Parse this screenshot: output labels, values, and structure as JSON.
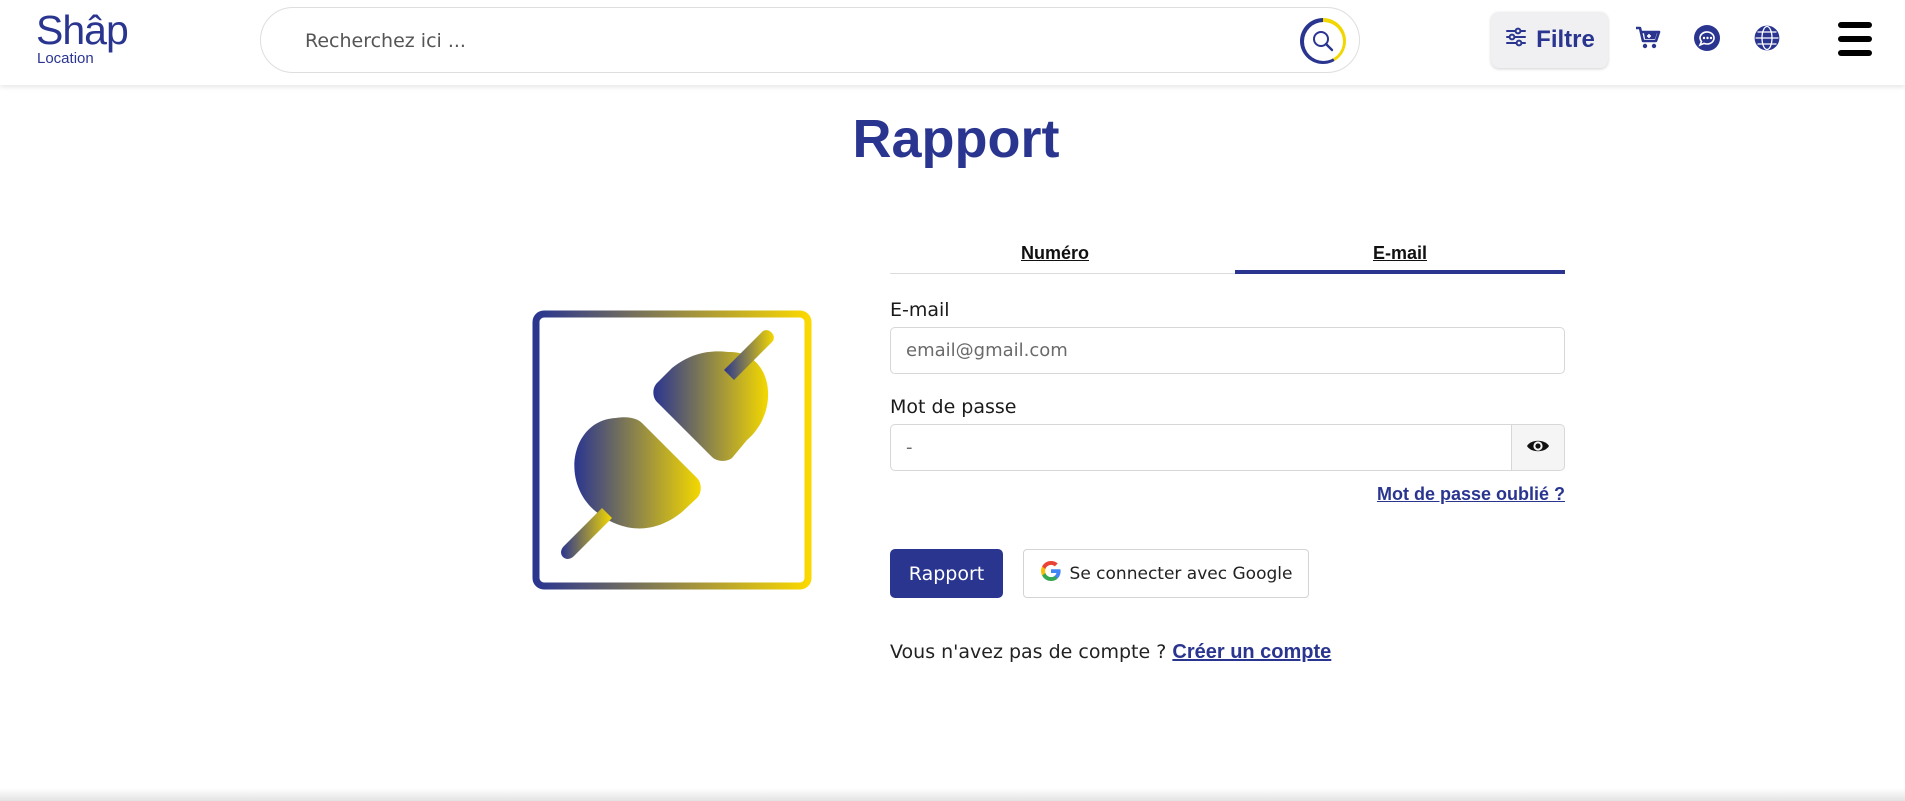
{
  "header": {
    "logo": {
      "main": "Shâp",
      "sub": "Location"
    },
    "search": {
      "placeholder": "Recherchez ici ..."
    },
    "filter_label": "Filtre",
    "icons": [
      "search-icon",
      "sliders-icon",
      "cart-icon",
      "chat-icon",
      "globe-icon",
      "menu-icon"
    ]
  },
  "main": {
    "title": "Rapport",
    "illustration_icon": "plug-icon",
    "tabs": [
      {
        "label": "Numéro",
        "active": false
      },
      {
        "label": "E-mail",
        "active": true
      }
    ],
    "form": {
      "email_label": "E-mail",
      "email_placeholder": "email@gmail.com",
      "password_label": "Mot de passe",
      "password_placeholder": "-",
      "forgot_label": "Mot de passe oublié ?",
      "submit_label": "Rapport",
      "google_label": "Se connecter avec Google"
    },
    "signup": {
      "prompt": "Vous n'avez pas de compte ?",
      "link": "Créer un compte"
    }
  },
  "colors": {
    "brand_blue": "#2a3590",
    "brand_yellow": "#f1d600"
  }
}
